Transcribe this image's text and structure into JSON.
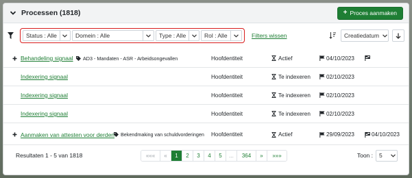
{
  "header": {
    "title": "Processen (1818)",
    "new_button": "Proces aanmaken"
  },
  "filters": {
    "status": "Status : Alle",
    "domein": "Domein : Alle",
    "type": "Type : Alle",
    "rol": "Rol : Alle",
    "clear_label": "Filters wissen",
    "sort_label": "Creatiedatum"
  },
  "rows": [
    {
      "name": "Behandeling signaal",
      "tag": "AD3 - Mandaten - ASR - Arbeidsongevallen",
      "entity": "Hoofdentiteit",
      "status": "Actief",
      "start": "04/10/2023",
      "end": ""
    },
    {
      "name": "Indexering signaal",
      "tag": "",
      "entity": "Hoofdentiteit",
      "status": "Te indexeren",
      "start": "02/10/2023",
      "end": ""
    },
    {
      "name": "Indexering signaal",
      "tag": "",
      "entity": "Hoofdentiteit",
      "status": "Te indexeren",
      "start": "02/10/2023",
      "end": ""
    },
    {
      "name": "Indexering signaal",
      "tag": "",
      "entity": "Hoofdentiteit",
      "status": "Te indexeren",
      "start": "02/10/2023",
      "end": ""
    },
    {
      "name": "Aanmaken van attesten voor derden",
      "tag": "Bekendmaking van schuldvorderingen",
      "entity": "Hoofdentiteit",
      "status": "Actief",
      "start": "29/09/2023",
      "end": "04/10/2023"
    }
  ],
  "footer": {
    "results": "Resultaten 1 - 5 van 1818",
    "pages": [
      "«««",
      "«",
      "1",
      "2",
      "3",
      "4",
      "5",
      "...",
      "364",
      "»",
      "»»»"
    ],
    "show_label": "Toon :",
    "show_value": "5"
  },
  "colors": {
    "accent": "#1e7e34",
    "filter_outline": "#d81b1b"
  }
}
